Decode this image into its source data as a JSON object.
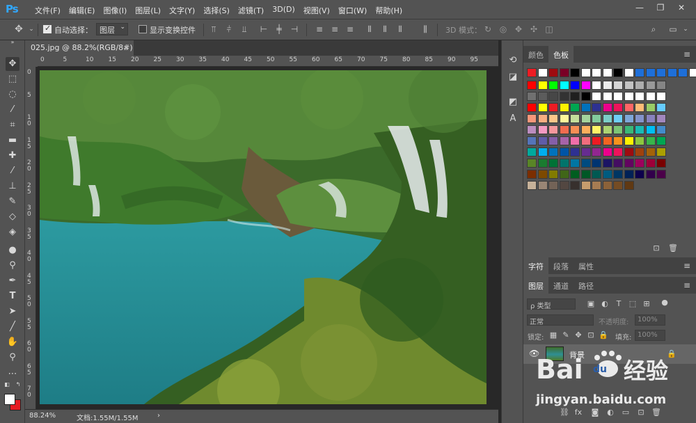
{
  "app": {
    "logo": "Ps"
  },
  "menu": [
    "文件(F)",
    "编辑(E)",
    "图像(I)",
    "图层(L)",
    "文字(Y)",
    "选择(S)",
    "滤镜(T)",
    "3D(D)",
    "视图(V)",
    "窗口(W)",
    "帮助(H)"
  ],
  "window_controls": {
    "minimize": "—",
    "maximize": "❐",
    "close": "✕"
  },
  "options": {
    "auto_select_label": "自动选择：",
    "auto_select_checked": true,
    "auto_select_target": "图层",
    "show_transform_label": "显示变换控件",
    "show_transform_checked": false,
    "mode_3d_label": "3D 模式："
  },
  "document": {
    "tab_title": "025.jpg @ 88.2%(RGB/8#)",
    "close": "×",
    "zoom": "88.24%",
    "doc_size": "文档:1.55M/1.55M",
    "status_arrow": "›"
  },
  "rulers": {
    "h_ticks": [
      "0",
      "5",
      "10",
      "15",
      "20",
      "25",
      "30",
      "35",
      "40",
      "45",
      "50",
      "55",
      "60",
      "65",
      "70",
      "75",
      "80",
      "85",
      "90",
      "95"
    ],
    "v_ticks": [
      "0",
      "5",
      "1\n0",
      "1\n5",
      "2\n0",
      "2\n5",
      "3\n0",
      "3\n5",
      "4\n0",
      "4\n5",
      "5\n0",
      "5\n5",
      "6\n0",
      "6\n5",
      "7\n0"
    ]
  },
  "panels": {
    "color_tabs": [
      "颜色",
      "色板"
    ],
    "type_tabs": [
      "字符",
      "段落",
      "属性"
    ],
    "layer_tabs": [
      "图层",
      "通道",
      "路径"
    ],
    "layer_filter": "ρ 类型",
    "blend_mode": "正常",
    "opacity_label": "不透明度:",
    "opacity_value": "100%",
    "lock_label": "锁定:",
    "fill_label": "填充:",
    "fill_value": "100%",
    "layer_name": "背景"
  },
  "swatch_colors": [
    [
      "#ed1c24",
      "#ffffff",
      "#9e0b0f",
      "#7a0026",
      "#000000",
      "#ffffff",
      "#ffffff",
      "#ffffff",
      "#000000",
      "#ffffff",
      "#1e6fd9",
      "#1e6fd9",
      "#1e6fd9",
      "#1e6fd9",
      "#1e6fd9",
      "#ffffff"
    ],
    [
      "#ff0000",
      "#ffff00",
      "#00ff00",
      "#00ffff",
      "#0000ff",
      "#ff00ff",
      "#ffffff",
      "#ebebeb",
      "#d6d6d6",
      "#c2c2c2",
      "#adadad",
      "#999999",
      "#858585"
    ],
    [
      "#707070",
      "#5c5c5c",
      "#474747",
      "#333333",
      "#1f1f1f",
      "#000000",
      "#ffffff",
      "#ffffff",
      "#ffffff",
      "#ffffff",
      "#ffffff",
      "#ffffff",
      "#ffffff"
    ],
    [
      "#ff0000",
      "#ffff00",
      "#ed1c24",
      "#fff200",
      "#00a651",
      "#0072bc",
      "#2e3192",
      "#ec008c",
      "#ed145b",
      "#ff6666",
      "#ffbb77",
      "#99cc66",
      "#66ccff"
    ],
    [
      "#f7977a",
      "#f9ad81",
      "#fdc68a",
      "#fff79a",
      "#c4df9b",
      "#a3d39c",
      "#82ca9d",
      "#7bcdc8",
      "#6ecff6",
      "#7ea7d8",
      "#8493ca",
      "#8882be",
      "#a187be"
    ],
    [
      "#bc8dbf",
      "#f49ac2",
      "#f6989d",
      "#f26c4f",
      "#f68e55",
      "#fbaf5c",
      "#fff467",
      "#acd372",
      "#7cc576",
      "#3bb878",
      "#1abbb4",
      "#00bff3",
      "#438ccb"
    ],
    [
      "#5574b9",
      "#605ca8",
      "#855fa8",
      "#a763a8",
      "#f06ea9",
      "#f26d7d",
      "#ed1c24",
      "#f26522",
      "#f7941d",
      "#fff200",
      "#8dc73f",
      "#39b54a",
      "#00a651"
    ],
    [
      "#00a99d",
      "#00aeef",
      "#0072bc",
      "#0054a6",
      "#2e3192",
      "#662d91",
      "#92278f",
      "#ec008c",
      "#ed145b",
      "#9e0b0f",
      "#a0410d",
      "#a36209",
      "#aba000"
    ],
    [
      "#598527",
      "#1a7b30",
      "#007236",
      "#00746b",
      "#0076a3",
      "#004b80",
      "#003471",
      "#1b1464",
      "#440e62",
      "#630460",
      "#9e005d",
      "#9e0039",
      "#790000"
    ],
    [
      "#7b2e00",
      "#7d4900",
      "#827b00",
      "#406618",
      "#005e20",
      "#005826",
      "#005952",
      "#005b7f",
      "#003663",
      "#002157",
      "#0d004c",
      "#32004b",
      "#4b0049"
    ],
    [
      "#c7b299",
      "#998675",
      "#736357",
      "#534741",
      "#37302d",
      "#c69c6d",
      "#a67c52",
      "#8c6239",
      "#754c24",
      "#603913"
    ]
  ]
}
